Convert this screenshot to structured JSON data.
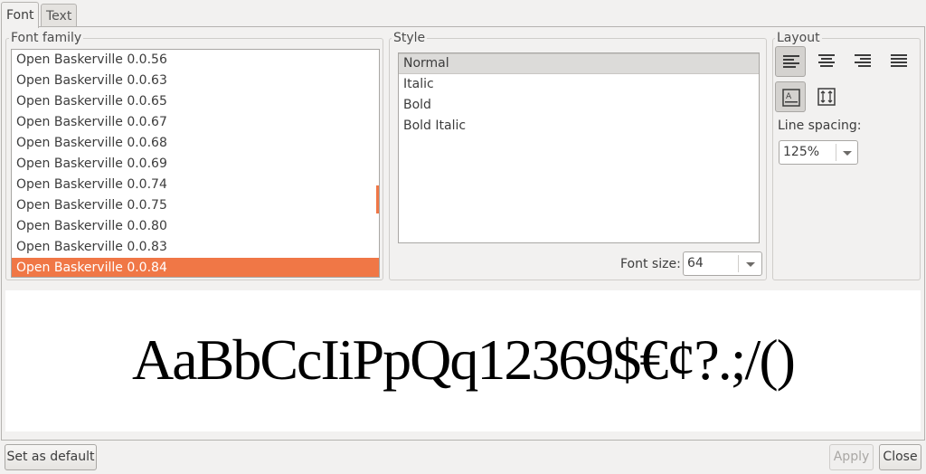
{
  "tabs": [
    {
      "label": "Font",
      "active": true
    },
    {
      "label": "Text",
      "active": false
    }
  ],
  "font_family": {
    "title": "Font family",
    "items": [
      "Open Baskerville 0.0.56",
      "Open Baskerville 0.0.63",
      "Open Baskerville 0.0.65",
      "Open Baskerville 0.0.67",
      "Open Baskerville 0.0.68",
      "Open Baskerville 0.0.69",
      "Open Baskerville 0.0.74",
      "Open Baskerville 0.0.75",
      "Open Baskerville 0.0.80",
      "Open Baskerville 0.0.83",
      "Open Baskerville 0.0.84"
    ],
    "selected_index": 10
  },
  "style": {
    "title": "Style",
    "items": [
      "Normal",
      "Italic",
      "Bold",
      "Bold Italic"
    ],
    "selected_index": 0,
    "font_size_label": "Font size:",
    "font_size_value": "64"
  },
  "layout": {
    "title": "Layout",
    "align_buttons": [
      "align-left-icon",
      "align-center-icon",
      "align-right-icon",
      "align-justify-icon"
    ],
    "active_align": "align-left-icon",
    "line_spacing_label": "Line spacing:",
    "line_spacing_value": "125%"
  },
  "preview": {
    "text": "AaBbCcIiPpQq12369$€¢?.;/()"
  },
  "buttons": {
    "set_default": "Set as default",
    "apply": "Apply",
    "close": "Close"
  },
  "colors": {
    "accent": "#f07746",
    "window_bg": "#f2f1f0"
  }
}
